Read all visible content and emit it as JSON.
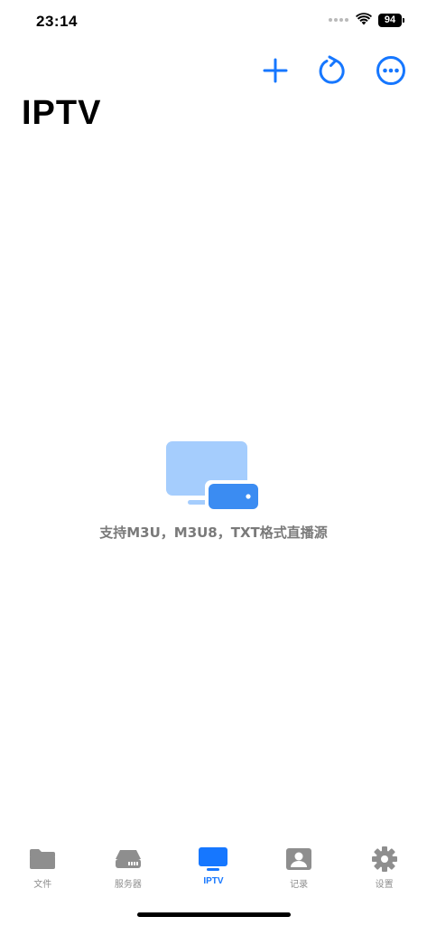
{
  "status_bar": {
    "time": "23:14",
    "battery": "94"
  },
  "nav_actions": {
    "add_icon": "plus-icon",
    "refresh_icon": "refresh-icon",
    "more_icon": "more-icon"
  },
  "header": {
    "title": "IPTV"
  },
  "empty_state": {
    "icon": "tv-icon",
    "message": "支持M3U，M3U8，TXT格式直播源"
  },
  "tab_bar": {
    "active": 2,
    "accent_color": "#1677ff",
    "inactive_color": "#8e8e8e",
    "items": [
      {
        "label": "文件",
        "icon": "folder-icon"
      },
      {
        "label": "服务器",
        "icon": "server-icon"
      },
      {
        "label": "IPTV",
        "icon": "tv-icon"
      },
      {
        "label": "记录",
        "icon": "contact-card-icon"
      },
      {
        "label": "设置",
        "icon": "gear-icon"
      }
    ]
  }
}
